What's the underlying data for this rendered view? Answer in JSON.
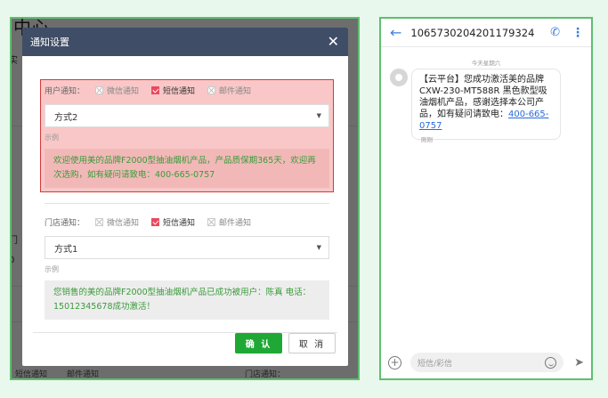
{
  "left": {
    "background": {
      "title": "中心",
      "fragments": [
        "实",
        "门",
        "0",
        "门",
        "0",
        "门",
        "(",
        "门"
      ],
      "bottom_left": "短信通知",
      "bottom_mid": "邮件通知",
      "bottom_right": "门店通知："
    },
    "modal": {
      "title": "通知设置",
      "close_icon": "close-icon",
      "user_section": {
        "label": "用户通知：",
        "options": [
          {
            "label": "微信通知",
            "checked": false
          },
          {
            "label": "短信通知",
            "checked": true
          },
          {
            "label": "邮件通知",
            "checked": false
          }
        ],
        "select_value": "方式2",
        "example_label": "示例",
        "example_text": "欢迎使用美的品牌F2000型抽油烟机产品，产品质保期365天，欢迎再次选购，如有疑问请致电：400-665-0757"
      },
      "store_section": {
        "label": "门店通知：",
        "options": [
          {
            "label": "微信通知",
            "checked": false
          },
          {
            "label": "短信通知",
            "checked": true
          },
          {
            "label": "邮件通知",
            "checked": false
          }
        ],
        "select_value": "方式1",
        "example_label": "示例",
        "example_text": "您销售的美的品牌F2000型抽油烟机产品已成功被用户：陈真 电话：15012345678成功激活！"
      },
      "confirm_label": "确 认",
      "cancel_label": "取 消"
    }
  },
  "right": {
    "sender": "1065730204201179324",
    "date_label": "今天星期六",
    "message": "【云平台】您成功激活美的品牌CXW-230-MT588R 黑色款型吸油烟机产品，感谢选择本公司产品，如有疑问请致电：",
    "message_link": "400-665-0757",
    "time_label": "刚刚",
    "input_placeholder": "短信/彩信"
  },
  "colors": {
    "frame_green": "#5dbf6f",
    "modal_header": "#3f4d66",
    "highlight_fill": "#f9c7c7",
    "highlight_border": "#d33a3a",
    "confirm_green": "#1fa835",
    "example_text_green": "#3a9b3a",
    "accent_blue": "#3c7ee0"
  }
}
